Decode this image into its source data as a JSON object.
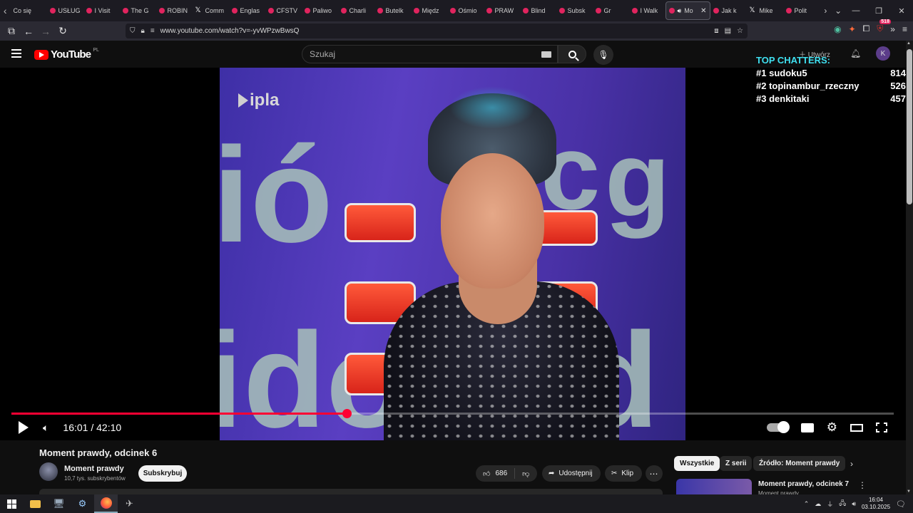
{
  "browser": {
    "tabs": [
      {
        "label": "Co się",
        "icon": "none"
      },
      {
        "label": "USŁUG",
        "icon": "youtube"
      },
      {
        "label": "I Visit",
        "icon": "youtube"
      },
      {
        "label": "The G",
        "icon": "youtube"
      },
      {
        "label": "ROBIN",
        "icon": "youtube"
      },
      {
        "label": "Comm",
        "icon": "x"
      },
      {
        "label": "Englas",
        "icon": "youtube"
      },
      {
        "label": "CFSTV",
        "icon": "youtube"
      },
      {
        "label": "Paliwo",
        "icon": "youtube"
      },
      {
        "label": "Charli",
        "icon": "youtube"
      },
      {
        "label": "Butelk",
        "icon": "youtube"
      },
      {
        "label": "Międz",
        "icon": "youtube"
      },
      {
        "label": "Ośmio",
        "icon": "youtube"
      },
      {
        "label": "PRAW",
        "icon": "youtube"
      },
      {
        "label": "Blind",
        "icon": "youtube"
      },
      {
        "label": "Subsk",
        "icon": "youtube"
      },
      {
        "label": "Gr",
        "icon": "youtube"
      },
      {
        "label": "I Walk",
        "icon": "youtube"
      },
      {
        "label": "Mo",
        "icon": "youtube",
        "active": true
      },
      {
        "label": "Jak k",
        "icon": "youtube"
      },
      {
        "label": "Mike",
        "icon": "x"
      },
      {
        "label": "Polit",
        "icon": "youtube"
      }
    ],
    "url": "www.youtube.com/watch?v=-yvWPzwBwsQ",
    "extension_badge": "518"
  },
  "youtube": {
    "wordmark": "YouTube",
    "country_code": "PL",
    "search_placeholder": "Szukaj",
    "create_label": "Utwórz",
    "avatar_letter": "K"
  },
  "player": {
    "current_time": "16:01",
    "separator": "/",
    "duration": "42:10",
    "progress_fraction": 0.38,
    "watermark": "ipla"
  },
  "chatters": {
    "title": "TOP CHATTERS:",
    "rows": [
      {
        "rank": "#1",
        "name": "sudoku5",
        "count": "814"
      },
      {
        "rank": "#2",
        "name": "topinambur_rzeczny",
        "count": "526"
      },
      {
        "rank": "#3",
        "name": "denkitaki",
        "count": "457"
      }
    ]
  },
  "video": {
    "title": "Moment prawdy, odcinek 6",
    "channel_name": "Moment prawdy",
    "subscribers": "10,7 tys. subskrybentów",
    "subscribe_label": "Subskrybuj",
    "likes": "686",
    "share_label": "Udostępnij",
    "clip_label": "Klip"
  },
  "sidebar": {
    "chips": [
      "Wszystkie",
      "Z serii",
      "Źródło: Moment prawdy"
    ],
    "recommendation": {
      "title": "Moment prawdy, odcinek 7",
      "channel": "Moment prawdy"
    }
  },
  "taskbar": {
    "time": "16:04",
    "date": "03.10.2025"
  },
  "colors": {
    "progress": "#ff0033",
    "chatters_title": "#3fe0f0",
    "yt_red": "#ff0000"
  }
}
